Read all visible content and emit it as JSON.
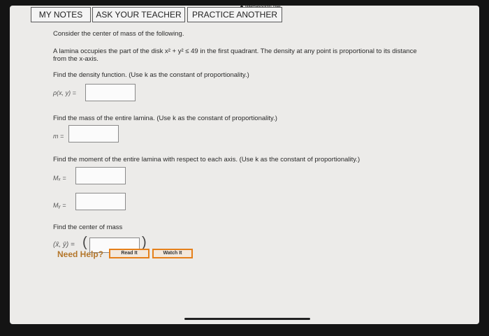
{
  "browser": {
    "site": "webassign.net"
  },
  "tabs": {
    "my_notes": "MY NOTES",
    "ask_teacher": "ASK YOUR TEACHER",
    "practice": "PRACTICE ANOTHER"
  },
  "problem": {
    "intro": "Consider the center of mass of the following.",
    "statement_line1": "A lamina occupies the part of the disk x² + y² ≤ 49 in the first quadrant. The density at any point is proportional to its distance",
    "statement_line2": "from the x-axis.",
    "q_density": "Find the density function. (Use k as the constant of proportionality.)",
    "density_label": "ρ(x, y) =",
    "density_value": "",
    "q_mass": "Find the mass of the entire lamina. (Use k as the constant of proportionality.)",
    "mass_label": "m =",
    "mass_value": "",
    "q_moment": "Find the moment of the entire lamina with respect to each axis. (Use k as the constant of proportionality.)",
    "mx_label": "Mₓ =",
    "mx_value": "",
    "my_label": "Mᵧ =",
    "my_value": "",
    "q_center": "Find the center of mass",
    "center_label": "(x̄, ȳ) =",
    "center_value": ""
  },
  "help": {
    "label": "Need Help?",
    "read_it": "Read It",
    "watch_it": "Watch It"
  }
}
